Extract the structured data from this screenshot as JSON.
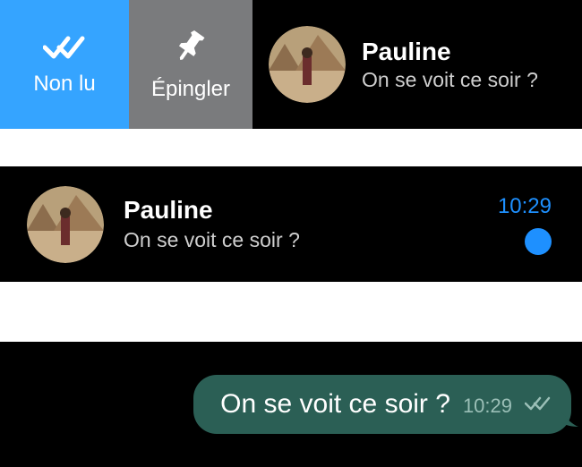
{
  "swipe_actions": {
    "unread_label": "Non lu",
    "pin_label": "Épingler"
  },
  "chat_row1": {
    "name": "Pauline",
    "preview": "On se voit ce soir ?"
  },
  "chat_row2": {
    "name": "Pauline",
    "preview": "On se voit ce soir ?",
    "time": "10:29"
  },
  "bubble": {
    "message": "On se voit ce soir ?",
    "time": "10:29"
  },
  "colors": {
    "unread_action": "#35a4ff",
    "pin_action": "#7a7b7d",
    "accent": "#1e90ff",
    "bubble": "#2b5f55"
  }
}
